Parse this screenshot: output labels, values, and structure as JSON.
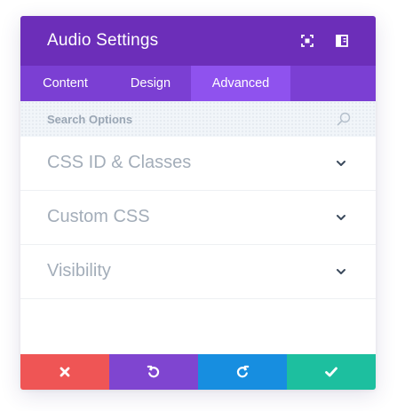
{
  "header": {
    "title": "Audio Settings",
    "expand_icon": "expand-icon",
    "sidebar_icon": "sidebar-layout-icon"
  },
  "tabs": [
    {
      "label": "Content",
      "active": false
    },
    {
      "label": "Design",
      "active": false
    },
    {
      "label": "Advanced",
      "active": true
    }
  ],
  "search": {
    "placeholder": "Search Options",
    "value": "",
    "icon": "search-icon"
  },
  "sections": [
    {
      "label": "CSS ID & Classes",
      "icon": "chevron-down-icon"
    },
    {
      "label": "Custom CSS",
      "icon": "chevron-down-icon"
    },
    {
      "label": "Visibility",
      "icon": "chevron-down-icon"
    }
  ],
  "footer": {
    "cancel_icon": "close-icon",
    "undo_icon": "undo-icon",
    "redo_icon": "redo-icon",
    "save_icon": "checkmark-icon"
  },
  "colors": {
    "header": "#6c2eb9",
    "tabs": "#7b3fd3",
    "tab_active": "#8f52ee",
    "cancel": "#ef5555",
    "undo": "#7f45d0",
    "redo": "#178ee0",
    "save": "#1dbf9f",
    "section_label": "#a3adb9",
    "chevron": "#3b4a5c"
  }
}
